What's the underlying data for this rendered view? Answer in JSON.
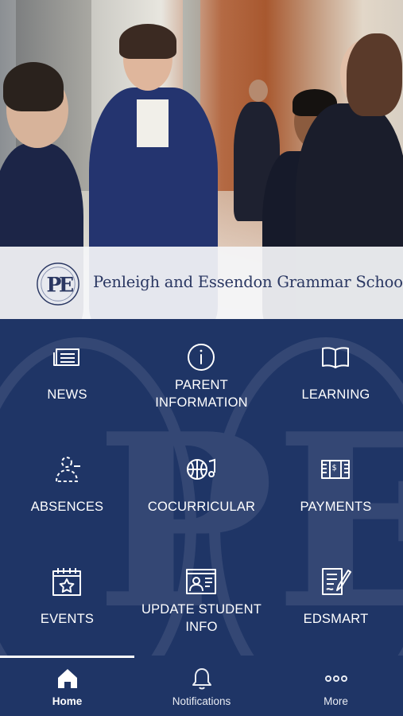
{
  "header": {
    "school_name": "Penleigh and Essendon Grammar School",
    "crest_monogram": "PE"
  },
  "tiles": [
    {
      "label": "NEWS",
      "icon": "news-icon"
    },
    {
      "label": "PARENT INFORMATION",
      "line1": "PARENT",
      "line2": "INFORMATION",
      "icon": "info-icon"
    },
    {
      "label": "LEARNING",
      "icon": "book-icon"
    },
    {
      "label": "ABSENCES",
      "icon": "absences-icon"
    },
    {
      "label": "COCURRICULAR",
      "icon": "cocurricular-icon"
    },
    {
      "label": "PAYMENTS",
      "icon": "payments-icon"
    },
    {
      "label": "EVENTS",
      "icon": "calendar-star-icon"
    },
    {
      "label": "UPDATE STUDENT INFO",
      "line1": "UPDATE STUDENT",
      "line2": "INFO",
      "icon": "student-profile-icon"
    },
    {
      "label": "EDSMART",
      "icon": "edsmart-icon"
    }
  ],
  "tabbar": {
    "items": [
      {
        "label": "Home",
        "icon": "home-icon",
        "active": true
      },
      {
        "label": "Notifications",
        "icon": "bell-icon",
        "active": false
      },
      {
        "label": "More",
        "icon": "more-icon",
        "active": false
      }
    ]
  },
  "colors": {
    "primary": "#1f3566",
    "text": "#ffffff",
    "banner": "#f4f5f7",
    "school_name": "#2a3762"
  }
}
